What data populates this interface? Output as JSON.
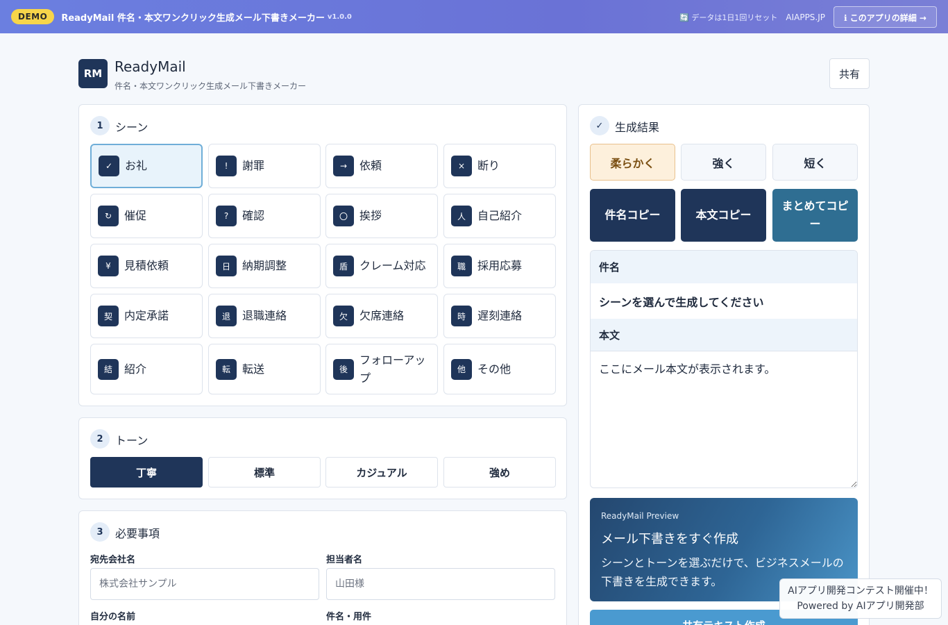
{
  "topbar": {
    "demo_badge": "DEMO",
    "title": "ReadyMail 件名・本文ワンクリック生成メール下書きメーカー",
    "version": "v1.0.0",
    "reset_note": "🔄 データは1日1回リセット",
    "site_link": "AIAPPS.JP",
    "about_button": "ℹ このアプリの詳細 →"
  },
  "header": {
    "logo": "RM",
    "name": "ReadyMail",
    "subtitle": "件名・本文ワンクリック生成メール下書きメーカー",
    "share_button": "共有"
  },
  "scene_section": {
    "number": "1",
    "title": "シーン",
    "selected": "お礼",
    "items": [
      {
        "icon": "✓",
        "icon_name": "check-icon",
        "label": "お礼"
      },
      {
        "icon": "!",
        "icon_name": "exclamation-icon",
        "label": "謝罪"
      },
      {
        "icon": "→",
        "icon_name": "arrow-right-icon",
        "label": "依頼"
      },
      {
        "icon": "×",
        "icon_name": "cross-icon",
        "label": "断り"
      },
      {
        "icon": "↻",
        "icon_name": "refresh-icon",
        "label": "催促"
      },
      {
        "icon": "?",
        "icon_name": "question-icon",
        "label": "確認"
      },
      {
        "icon": "〇",
        "icon_name": "circle-icon",
        "label": "挨拶"
      },
      {
        "icon": "人",
        "icon_name": "person-icon",
        "label": "自己紹介"
      },
      {
        "icon": "¥",
        "icon_name": "yen-icon",
        "label": "見積依頼"
      },
      {
        "icon": "日",
        "icon_name": "calendar-icon",
        "label": "納期調整"
      },
      {
        "icon": "盾",
        "icon_name": "shield-icon",
        "label": "クレーム対応"
      },
      {
        "icon": "職",
        "icon_name": "job-icon",
        "label": "採用応募"
      },
      {
        "icon": "契",
        "icon_name": "contract-icon",
        "label": "内定承諾"
      },
      {
        "icon": "退",
        "icon_name": "leave-icon",
        "label": "退職連絡"
      },
      {
        "icon": "欠",
        "icon_name": "absence-icon",
        "label": "欠席連絡"
      },
      {
        "icon": "時",
        "icon_name": "clock-icon",
        "label": "遅刻連絡"
      },
      {
        "icon": "結",
        "icon_name": "link-icon",
        "label": "紹介"
      },
      {
        "icon": "転",
        "icon_name": "forward-icon",
        "label": "転送"
      },
      {
        "icon": "後",
        "icon_name": "followup-icon",
        "label": "フォローアップ"
      },
      {
        "icon": "他",
        "icon_name": "other-icon",
        "label": "その他"
      }
    ]
  },
  "tone_section": {
    "number": "2",
    "title": "トーン",
    "options": [
      "丁寧",
      "標準",
      "カジュアル",
      "強め"
    ],
    "selected": "丁寧"
  },
  "details_section": {
    "number": "3",
    "title": "必要事項",
    "fields": [
      {
        "label": "宛先会社名",
        "placeholder": "株式会社サンプル"
      },
      {
        "label": "担当者名",
        "placeholder": "山田様"
      },
      {
        "label": "自分の名前"
      },
      {
        "label": "件名・用件"
      }
    ]
  },
  "result": {
    "check_icon": "✓",
    "title": "生成結果",
    "variants": [
      "柔らかく",
      "強く",
      "短く"
    ],
    "selected_variant": "柔らかく",
    "copy_subject": "件名コピー",
    "copy_body": "本文コピー",
    "copy_all": "まとめてコピー",
    "subject_label": "件名",
    "subject_value": "シーンを選んで生成してください",
    "body_label": "本文",
    "body_value": "ここにメール本文が表示されます。"
  },
  "preview": {
    "tag": "ReadyMail Preview",
    "title": "メール下書きをすぐ作成",
    "description": "シーンとトーンを選ぶだけで、ビジネスメールの下書きを生成できます。",
    "share_text_button": "共有テキスト作成"
  },
  "contest": {
    "line1": "AIアプリ開発コンテスト開催中！",
    "line2": "Powered by AIアプリ開発部"
  }
}
